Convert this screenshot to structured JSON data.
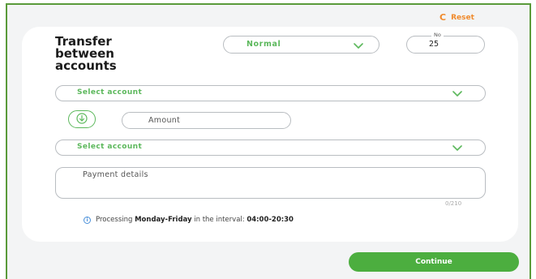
{
  "header": {
    "reset_label": "Reset"
  },
  "form": {
    "title_line1": "Transfer",
    "title_line2": "between",
    "title_line3": "accounts",
    "transfer_type": "Normal",
    "number_label": "No",
    "number_value": "25",
    "from_account_placeholder": "Select account",
    "amount_placeholder": "Amount",
    "to_account_placeholder": "Select account",
    "details_placeholder": "Payment details",
    "details_counter": "0/210"
  },
  "info": {
    "prefix": "Processing",
    "days": "Monday-Friday",
    "middle": "in the interval:",
    "hours": "04:00-20:30"
  },
  "footer": {
    "continue_label": "Continue"
  },
  "colors": {
    "accent": "#5cb85c",
    "reset": "#f08a2c",
    "button": "#4cae3f",
    "info_icon": "#4a90d9"
  },
  "icons": [
    "reset-icon",
    "chevron-down-icon",
    "arrow-down-icon",
    "info-icon"
  ]
}
